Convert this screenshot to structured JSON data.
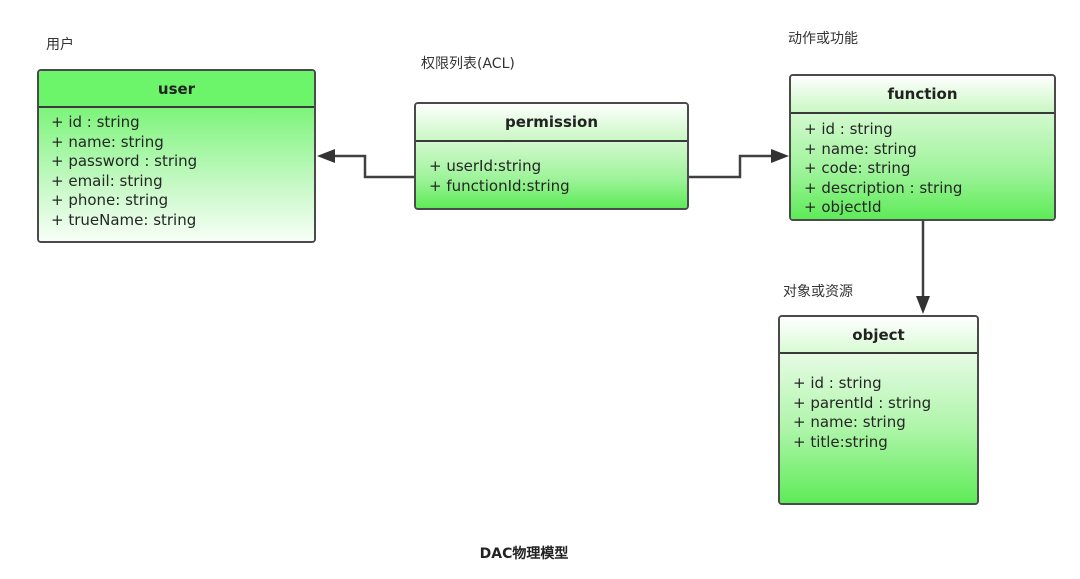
{
  "diagram": {
    "caption": "DAC物理模型",
    "labels": {
      "user": "用户",
      "permission": "权限列表(ACL)",
      "function": "动作或功能",
      "object": "对象或资源"
    },
    "classes": {
      "user": {
        "name": "user",
        "attributes": [
          "+ id : string",
          "+ name: string",
          "+ password : string",
          "+ email: string",
          "+ phone: string",
          "+ trueName: string"
        ]
      },
      "permission": {
        "name": "permission",
        "attributes": [
          "+ userId:string",
          "+ functionId:string"
        ]
      },
      "function": {
        "name": "function",
        "attributes": [
          "+ id : string",
          "+ name: string",
          "+ code: string",
          "+ description : string",
          "+ objectId"
        ]
      },
      "object": {
        "name": "object",
        "attributes": [
          "+ id : string",
          "+ parentId : string",
          "+ name: string",
          "+ title:string"
        ]
      }
    },
    "relations": [
      {
        "from": "permission",
        "to": "user",
        "type": "association-arrow"
      },
      {
        "from": "permission",
        "to": "function",
        "type": "association-arrow"
      },
      {
        "from": "function",
        "to": "object",
        "type": "association-arrow"
      }
    ],
    "colors": {
      "header_green": "#6cf56a",
      "body_green": "#5eeb58",
      "border": "#4a4a4a",
      "connector": "#404040"
    }
  }
}
